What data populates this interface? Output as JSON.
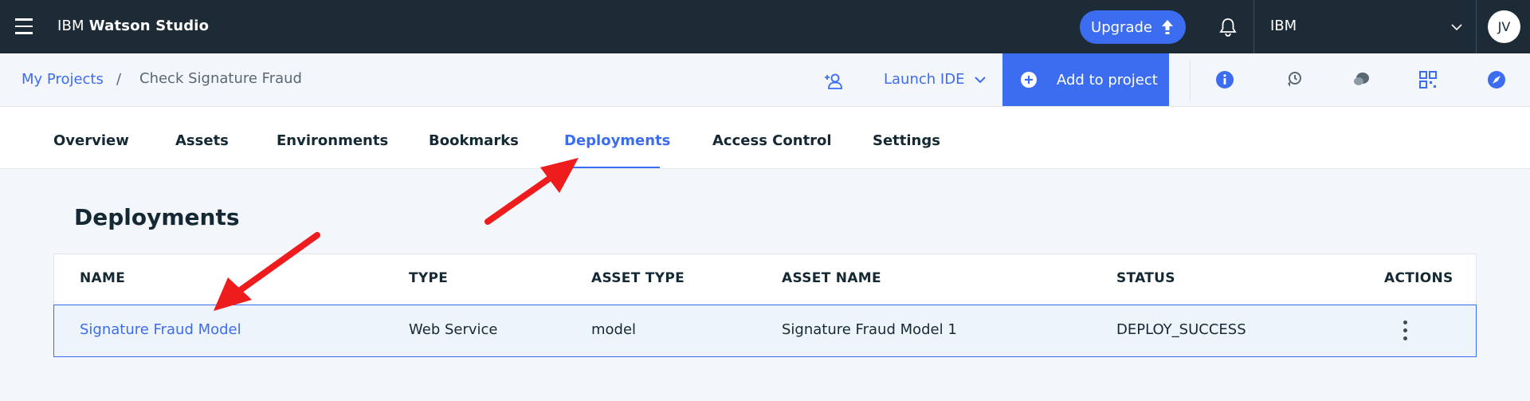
{
  "topbar": {
    "brand_prefix": "IBM",
    "brand_product": "Watson Studio",
    "upgrade_label": "Upgrade",
    "account_label": "IBM",
    "avatar_initials": "JV",
    "icons": [
      "menu-icon",
      "upload-arrow-icon",
      "bell-icon",
      "chevron-down-icon"
    ]
  },
  "breadcrumb": {
    "root": "My Projects",
    "separator": "/",
    "current": "Check Signature Fraud"
  },
  "subbar": {
    "launch_ide_label": "Launch IDE",
    "add_to_project_label": "Add to project",
    "icons": [
      "add-collaborator-icon",
      "info-icon",
      "history-icon",
      "chat-icon",
      "qr-icon",
      "compass-icon"
    ]
  },
  "tabs": [
    {
      "label": "Overview",
      "active": false
    },
    {
      "label": "Assets",
      "active": false
    },
    {
      "label": "Environments",
      "active": false
    },
    {
      "label": "Bookmarks",
      "active": false
    },
    {
      "label": "Deployments",
      "active": true
    },
    {
      "label": "Access Control",
      "active": false
    },
    {
      "label": "Settings",
      "active": false
    }
  ],
  "section": {
    "title": "Deployments"
  },
  "table": {
    "headers": [
      "NAME",
      "TYPE",
      "ASSET TYPE",
      "ASSET NAME",
      "STATUS",
      "ACTIONS"
    ],
    "rows": [
      {
        "name": "Signature Fraud Model",
        "type": "Web Service",
        "asset_type": "model",
        "asset_name": "Signature Fraud Model 1",
        "status": "DEPLOY_SUCCESS"
      }
    ]
  },
  "colors": {
    "topbar": "#1d2b36",
    "accent": "#3c6df0",
    "annotation_arrow": "#ee1c1c"
  }
}
